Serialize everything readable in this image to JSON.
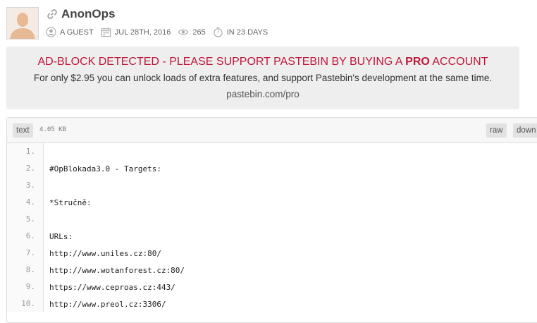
{
  "paste": {
    "title": "AnonOps",
    "author": "A GUEST",
    "date": "JUL 28TH, 2016",
    "views": "265",
    "expires": "IN 23 DAYS"
  },
  "banner": {
    "headline_before": "AD-BLOCK DETECTED - PLEASE SUPPORT PASTEBIN BY BUYING A ",
    "headline_bold": "PRO",
    "headline_after": " ACCOUNT",
    "text": "For only $2.95 you can unlock loads of extra features, and support Pastebin's development at the same time.",
    "link": "pastebin.com/pro"
  },
  "toolbar": {
    "syntax": "text",
    "size": "4.05 KB",
    "raw_label": "raw",
    "download_label": "down"
  },
  "code": {
    "lines": [
      {
        "n": "1.",
        "t": ""
      },
      {
        "n": "2.",
        "t": "#OpBlokada3.0 - Targets:"
      },
      {
        "n": "3.",
        "t": ""
      },
      {
        "n": "4.",
        "t": "*Stručně:"
      },
      {
        "n": "5.",
        "t": ""
      },
      {
        "n": "6.",
        "t": "URLs:"
      },
      {
        "n": "7.",
        "t": "http://www.uniles.cz:80/"
      },
      {
        "n": "8.",
        "t": "http://www.wotanforest.cz:80/"
      },
      {
        "n": "9.",
        "t": "https://www.ceproas.cz:443/"
      },
      {
        "n": "10.",
        "t": "http://www.preol.cz:3306/"
      }
    ]
  },
  "colors": {
    "accent": "#c0163a",
    "banner_bg": "#eeeeee"
  }
}
